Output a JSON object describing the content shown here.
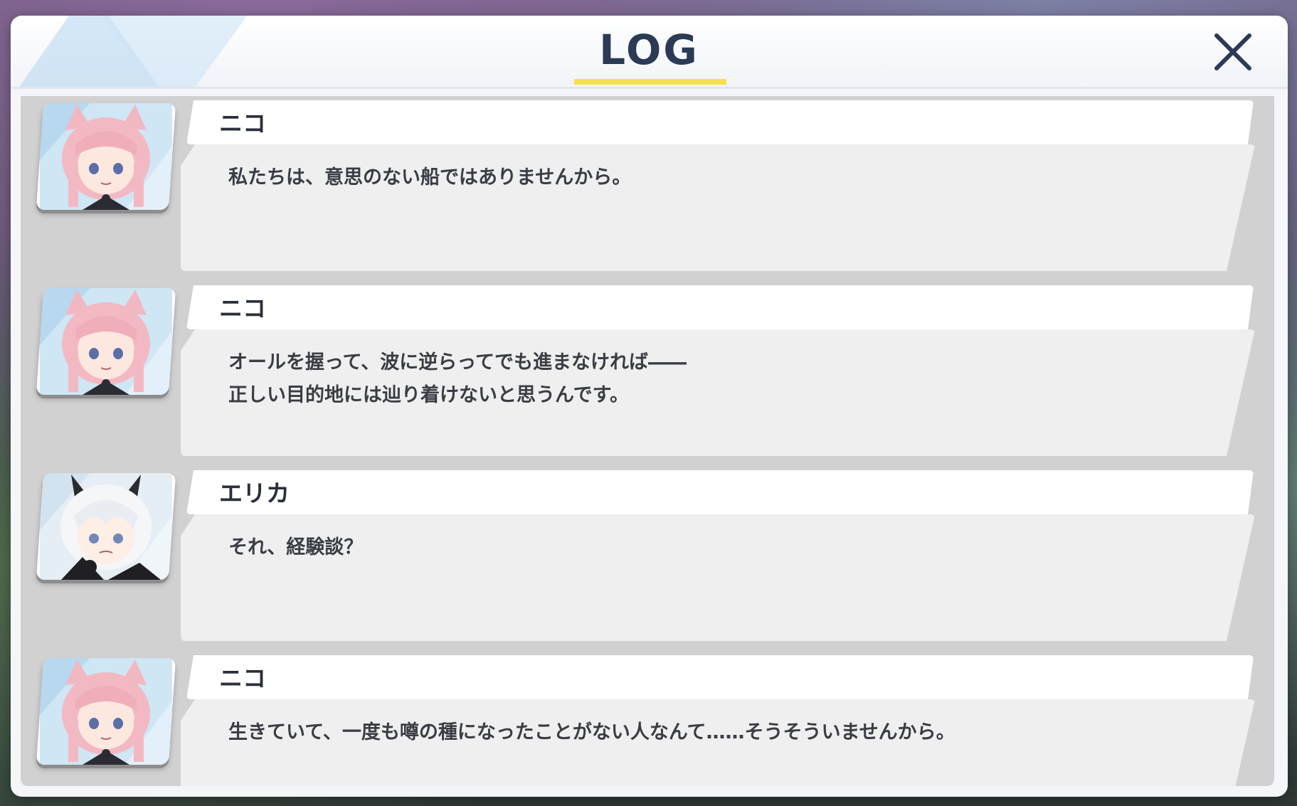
{
  "header": {
    "title": "LOG",
    "close_icon": "close-icon"
  },
  "colors": {
    "title": "#2b3a55",
    "underline": "#f7e14a",
    "name_bg": "#ffffff",
    "text_bg": "#efefef",
    "log_bg": "#d1d1d1"
  },
  "entries": [
    {
      "name": "ニコ",
      "portrait": "pink-hair-character",
      "lines": [
        "私たちは、意思のない船ではありませんから。"
      ]
    },
    {
      "name": "ニコ",
      "portrait": "pink-hair-character",
      "lines": [
        "オールを握って、波に逆らってでも進まなければ――",
        "正しい目的地には辿り着けないと思うんです。"
      ]
    },
    {
      "name": "エリカ",
      "portrait": "white-hair-horned-character",
      "lines": [
        "それ、経験談？"
      ]
    },
    {
      "name": "ニコ",
      "portrait": "pink-hair-character",
      "lines": [
        "生きていて、一度も噂の種になったことがない人なんて……そうそういませんから。"
      ]
    }
  ]
}
